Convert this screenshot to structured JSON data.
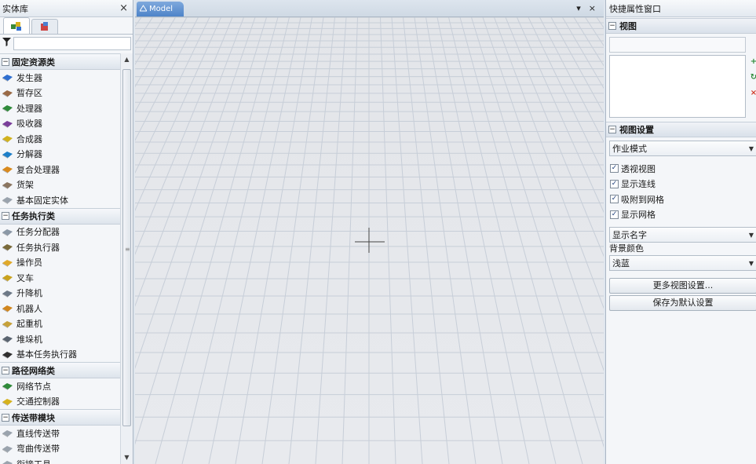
{
  "library": {
    "title": "实体库",
    "close": "×",
    "filter_icon": "funnel-icon",
    "filter_value": "",
    "groups": [
      {
        "label": "固定资源类",
        "toggle": "−",
        "items": [
          {
            "label": "发生器",
            "icon": "source-icon",
            "color": "#2f6fd0"
          },
          {
            "label": "暂存区",
            "icon": "queue-icon",
            "color": "#9a6a46"
          },
          {
            "label": "处理器",
            "icon": "processor-icon",
            "color": "#2f8a3a"
          },
          {
            "label": "吸收器",
            "icon": "sink-icon",
            "color": "#7a3e9a"
          },
          {
            "label": "合成器",
            "icon": "combiner-icon",
            "color": "#d1b21e"
          },
          {
            "label": "分解器",
            "icon": "separator-icon",
            "color": "#1e7fc8"
          },
          {
            "label": "复合处理器",
            "icon": "multiprocessor-icon",
            "color": "#d98a1e"
          },
          {
            "label": "货架",
            "icon": "rack-icon",
            "color": "#8a7560"
          },
          {
            "label": "基本固定实体",
            "icon": "basic-fr-icon",
            "color": "#9aa3ad"
          }
        ]
      },
      {
        "label": "任务执行类",
        "toggle": "−",
        "items": [
          {
            "label": "任务分配器",
            "icon": "dispatcher-icon",
            "color": "#8b98a6"
          },
          {
            "label": "任务执行器",
            "icon": "task-executer-icon",
            "color": "#7a6a3a"
          },
          {
            "label": "操作员",
            "icon": "operator-icon",
            "color": "#e0a92a"
          },
          {
            "label": "叉车",
            "icon": "forklift-icon",
            "color": "#c9a21e"
          },
          {
            "label": "升降机",
            "icon": "elevator-icon",
            "color": "#6c7886"
          },
          {
            "label": "机器人",
            "icon": "robot-icon",
            "color": "#d1861e"
          },
          {
            "label": "起重机",
            "icon": "crane-icon",
            "color": "#c6a13a"
          },
          {
            "label": "堆垛机",
            "icon": "asrs-icon",
            "color": "#5a6470"
          },
          {
            "label": "基本任务执行器",
            "icon": "basic-te-icon",
            "color": "#303030"
          }
        ]
      },
      {
        "label": "路径网络类",
        "toggle": "−",
        "items": [
          {
            "label": "网络节点",
            "icon": "network-node-icon",
            "color": "#2f8a3a"
          },
          {
            "label": "交通控制器",
            "icon": "traffic-control-icon",
            "color": "#d6b21e"
          }
        ]
      },
      {
        "label": "传送带模块",
        "toggle": "−",
        "items": [
          {
            "label": "直线传送带",
            "icon": "straight-conveyor-icon",
            "color": "#9aa3ad"
          },
          {
            "label": "弯曲传送带",
            "icon": "curved-conveyor-icon",
            "color": "#9aa3ad"
          },
          {
            "label": "衔接工具",
            "icon": "join-conveyor-icon",
            "color": "#9aa3ad"
          }
        ]
      }
    ]
  },
  "model_view": {
    "tab_label": "Model",
    "tab_icon": "model-view-icon",
    "dropdown_glyph": "▾",
    "close_glyph": "×"
  },
  "quick_props": {
    "title": "快捷属性窗口",
    "view_section": "视图",
    "view_name_value": "",
    "add_icon": "add-icon",
    "refresh_icon": "refresh-icon",
    "delete_icon": "delete-icon",
    "view_settings_section": "视图设置",
    "view_mode": "作业模式",
    "checks": [
      {
        "label": "透视视图",
        "checked": true
      },
      {
        "label": "显示连线",
        "checked": true
      },
      {
        "label": "吸附到网格",
        "checked": true
      },
      {
        "label": "显示网格",
        "checked": true
      }
    ],
    "name_display": "显示名字",
    "bg_color_label": "背景颜色",
    "bg_color_value": "浅蓝",
    "more_settings_button": "更多视图设置...",
    "save_default_button": "保存为默认设置",
    "toggle": "−"
  }
}
